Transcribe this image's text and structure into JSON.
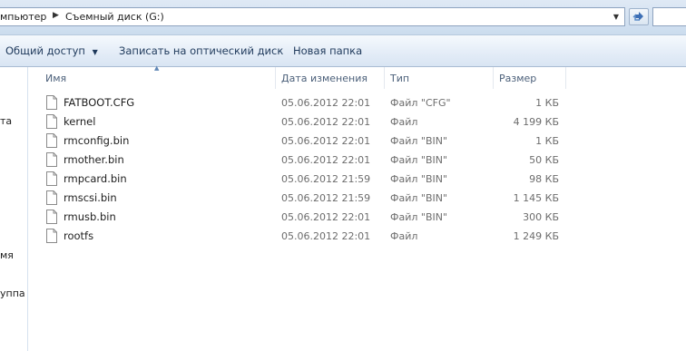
{
  "address": {
    "crumb_prev": "мпьютер",
    "crumb_current": "Съемный диск (G:)"
  },
  "toolbar": {
    "share_label": "Общий доступ",
    "burn_label": "Записать на оптический диск",
    "new_folder_label": "Новая папка"
  },
  "nav": {
    "fragments": [
      "та",
      "мя",
      "уппа"
    ]
  },
  "columns": {
    "name": "Имя",
    "date": "Дата изменения",
    "type": "Тип",
    "size": "Размер"
  },
  "files": [
    {
      "name": "FATBOOT.CFG",
      "date": "05.06.2012 22:01",
      "type": "Файл \"CFG\"",
      "size": "1 КБ"
    },
    {
      "name": "kernel",
      "date": "05.06.2012 22:01",
      "type": "Файл",
      "size": "4 199 КБ"
    },
    {
      "name": "rmconfig.bin",
      "date": "05.06.2012 22:01",
      "type": "Файл \"BIN\"",
      "size": "1 КБ"
    },
    {
      "name": "rmother.bin",
      "date": "05.06.2012 22:01",
      "type": "Файл \"BIN\"",
      "size": "50 КБ"
    },
    {
      "name": "rmpcard.bin",
      "date": "05.06.2012 21:59",
      "type": "Файл \"BIN\"",
      "size": "98 КБ"
    },
    {
      "name": "rmscsi.bin",
      "date": "05.06.2012 21:59",
      "type": "Файл \"BIN\"",
      "size": "1 145 КБ"
    },
    {
      "name": "rmusb.bin",
      "date": "05.06.2012 22:01",
      "type": "Файл \"BIN\"",
      "size": "300 КБ"
    },
    {
      "name": "rootfs",
      "date": "05.06.2012 22:01",
      "type": "Файл",
      "size": "1 249 КБ"
    }
  ],
  "icons": {
    "file": "file-icon",
    "breadcrumb_separator": "chevron-right-icon",
    "dropdown": "chevron-down-icon",
    "refresh": "refresh-icon",
    "sort": "sort-up-icon"
  }
}
